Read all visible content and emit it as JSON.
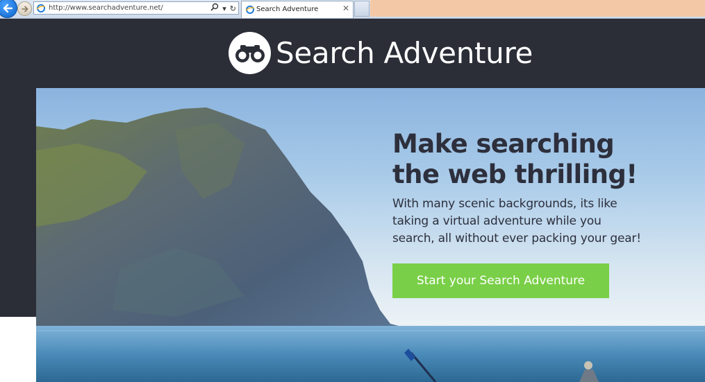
{
  "browser": {
    "url": "http://www.searchadventure.net/",
    "tab_title": "Search Adventure",
    "search_icon": "search-icon",
    "dropdown_glyph": "▾",
    "refresh_glyph": "↻",
    "close_glyph": "✕"
  },
  "site": {
    "logo_text": "Search Adventure",
    "logo_icon": "binoculars-icon",
    "header_color": "#2b2d37"
  },
  "hero": {
    "headline": "Make searching the web thrilling!",
    "subtext": "With many scenic backgrounds, its like taking a virtual adventure while you search, all without ever packing your gear!",
    "cta_label": "Start your Search Adventure",
    "cta_color": "#79cf47"
  }
}
